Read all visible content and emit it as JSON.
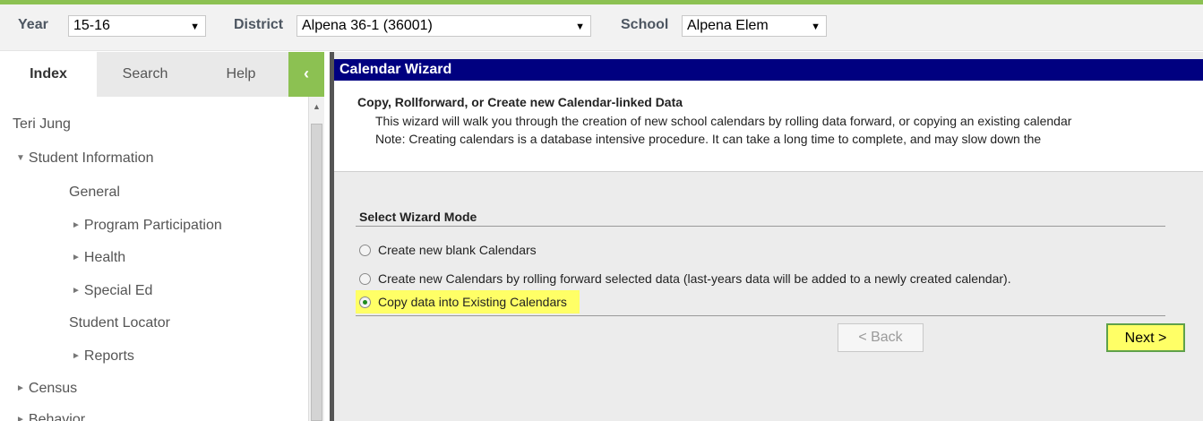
{
  "header": {
    "year_label": "Year",
    "year_value": "15-16",
    "district_label": "District",
    "district_value": "Alpena 36-1 (36001)",
    "school_label": "School",
    "school_value": "Alpena Elem"
  },
  "sidebar": {
    "tabs": [
      "Index",
      "Search",
      "Help"
    ],
    "collapse_glyph": "‹",
    "tree": [
      {
        "label": "Teri Jung",
        "expander": ""
      },
      {
        "label": "Student Information",
        "expander": "▼"
      },
      {
        "label": "General",
        "expander": ""
      },
      {
        "label": "Program Participation",
        "expander": "►"
      },
      {
        "label": "Health",
        "expander": "►"
      },
      {
        "label": "Special Ed",
        "expander": "►"
      },
      {
        "label": "Student Locator",
        "expander": ""
      },
      {
        "label": "Reports",
        "expander": "►"
      },
      {
        "label": "Census",
        "expander": "►"
      },
      {
        "label": "Behavior",
        "expander": "►"
      }
    ]
  },
  "wizard": {
    "title": "Calendar Wizard",
    "heading": "Copy, Rollforward, or Create new Calendar-linked Data",
    "line1": "This wizard will walk you through the creation of new school calendars by rolling data forward, or copying an existing calendar",
    "line2": "Note: Creating calendars is a database intensive procedure. It can take a long time to complete, and may slow down the",
    "mode_title": "Select Wizard Mode",
    "options": [
      {
        "label": "Create new blank Calendars",
        "checked": false
      },
      {
        "label": "Create new Calendars by rolling forward selected data (last-years data will be added to a newly created calendar).",
        "checked": false
      },
      {
        "label": "Copy data into Existing Calendars",
        "checked": true
      }
    ],
    "back_label": "< Back",
    "next_label": "Next >"
  },
  "colors": {
    "accent_green": "#8cc152",
    "title_bar": "#000080",
    "highlight": "#ffff66"
  }
}
